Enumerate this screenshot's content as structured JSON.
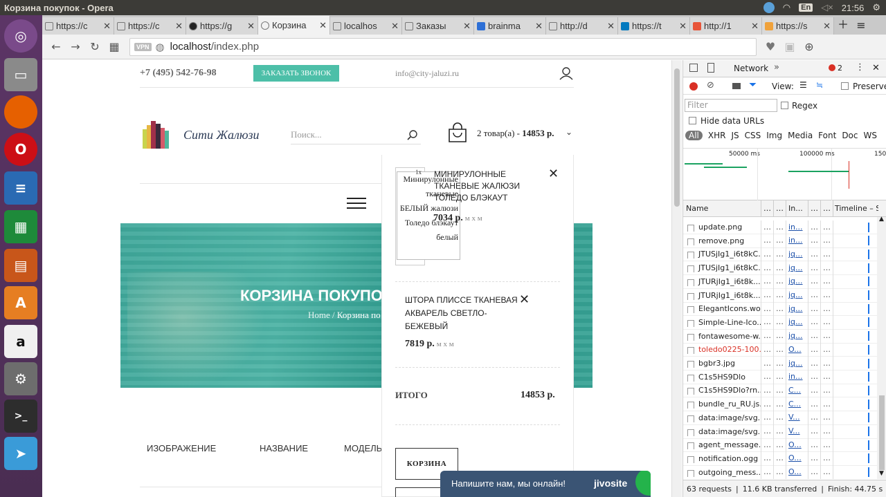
{
  "window": {
    "title": "Корзина покупок - Opera",
    "time": "21:56",
    "lang": "En"
  },
  "tabs": [
    {
      "label": "https://c",
      "active": false
    },
    {
      "label": "https://c",
      "active": false
    },
    {
      "label": "https://g",
      "active": false
    },
    {
      "label": "Корзина",
      "active": true
    },
    {
      "label": "localhos",
      "active": false
    },
    {
      "label": "Заказы",
      "active": false
    },
    {
      "label": "brainma",
      "active": false
    },
    {
      "label": "http://d",
      "active": false
    },
    {
      "label": "https://t",
      "active": false
    },
    {
      "label": "http://1",
      "active": false
    },
    {
      "label": "https://s",
      "active": false
    }
  ],
  "address": {
    "vpn": "VPN",
    "host": "localhost",
    "path": "/index.php"
  },
  "site": {
    "phone": "+7 (495) 542-76-98",
    "callback": "ЗАКАЗАТЬ ЗВОНОК",
    "email": "info@city-jaluzi.ru",
    "logo": "Сити Жалюзи",
    "search_placeholder": "Поиск...",
    "cart_summary": "2 товар(а) - ",
    "cart_total_bold": "14853 р.",
    "hero_title": "КОРЗИНА ПОКУПОК",
    "breadcrumb_home": "Home",
    "breadcrumb_sep": " / ",
    "breadcrumb_current": "Корзина по",
    "columns": [
      "ИЗОБРАЖЕНИЕ",
      "НАЗВАНИЕ",
      "МОДЕЛЬ"
    ]
  },
  "cart": {
    "items": [
      {
        "name": "МИНИРУЛОННЫЕ ТКАНЕВЫЕ ЖАЛЮЗИ ТОЛЕДО БЛЭКАУТ",
        "img_alt": "Минирулонные тканевые БЕЛЫЙ жалюзи Толедо блэкаут белый",
        "qty": "1x",
        "price": "7034 р.",
        "size": "м х м"
      },
      {
        "name": "ШТОРА ПЛИССЕ ТКАНЕВАЯ АКВАРЕЛЬ СВЕТЛО-БЕЖЕВЫЙ",
        "price": "7819 р.",
        "size": "м х м"
      }
    ],
    "total_label": "ИТОГО",
    "total_value": "14853 р.",
    "cart_button": "КОРЗИНА"
  },
  "chat": {
    "text": "Напишите нам, мы онлайн!",
    "brand": "jivosite"
  },
  "devtools": {
    "tab": "Network",
    "errors": "2",
    "view_label": "View:",
    "preserve": "Preserve",
    "filter_placeholder": "Filter",
    "regex": "Regex",
    "hide_data_urls": "Hide data URLs",
    "types": [
      "All",
      "XHR",
      "JS",
      "CSS",
      "Img",
      "Media",
      "Font",
      "Doc",
      "WS"
    ],
    "ticks": [
      "50000 ms",
      "100000 ms",
      "150"
    ],
    "col_name": "Name",
    "col_init": "In...",
    "col_timeline": "Timeline – Sta",
    "rows": [
      {
        "name": "update.png",
        "init": "in...",
        "red": false
      },
      {
        "name": "remove.png",
        "init": "in...",
        "red": false
      },
      {
        "name": "JTUSjIg1_i6t8kC...",
        "init": "jq...",
        "red": false
      },
      {
        "name": "JTUSjIg1_i6t8kC...",
        "init": "jq...",
        "red": false
      },
      {
        "name": "JTURjIg1_i6t8k...",
        "init": "jq...",
        "red": false
      },
      {
        "name": "JTURjIg1_i6t8k...",
        "init": "jq...",
        "red": false
      },
      {
        "name": "ElegantIcons.woff",
        "init": "jq...",
        "red": false
      },
      {
        "name": "Simple-Line-Ico...",
        "init": "jq...",
        "red": false
      },
      {
        "name": "fontawesome-w...",
        "init": "jq...",
        "red": false
      },
      {
        "name": "toledo0225-100...",
        "init": "O...",
        "red": true
      },
      {
        "name": "bgbr3.jpg",
        "init": "jq...",
        "red": false
      },
      {
        "name": "C1s5HS9Dlo",
        "init": "in...",
        "red": false
      },
      {
        "name": "C1s5HS9Dlo?rn...",
        "init": "C...",
        "red": false
      },
      {
        "name": "bundle_ru_RU.js...",
        "init": "C...",
        "red": false
      },
      {
        "name": "data:image/svg...",
        "init": "V...",
        "red": false
      },
      {
        "name": "data:image/svg...",
        "init": "V...",
        "red": false
      },
      {
        "name": "agent_message....",
        "init": "O...",
        "red": false
      },
      {
        "name": "notification.ogg",
        "init": "O...",
        "red": false
      },
      {
        "name": "outgoing_mess...",
        "init": "O...",
        "red": false
      }
    ],
    "status": {
      "requests": "63 requests",
      "transferred": "11.6 KB transferred",
      "finish": "Finish: 44.75 s"
    }
  }
}
